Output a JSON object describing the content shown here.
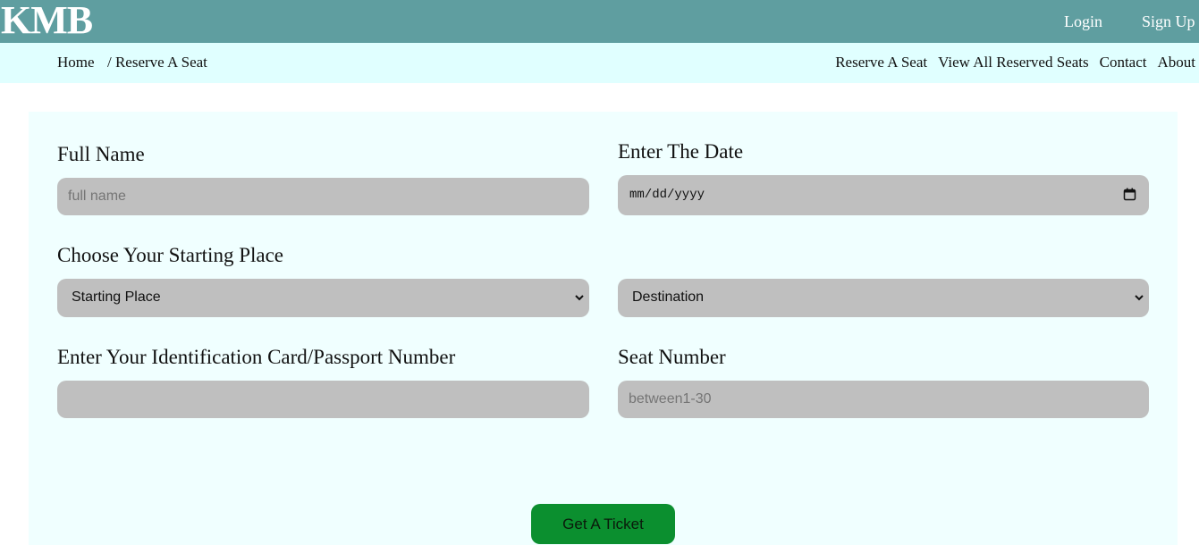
{
  "header": {
    "logo": "KMB",
    "login_label": "Login",
    "signup_label": "Sign Up"
  },
  "breadcrumb": {
    "home": "Home",
    "current": "/ Reserve A Seat"
  },
  "nav": {
    "items": [
      "Reserve A Seat",
      "View All Reserved Seats",
      "Contact",
      "About"
    ]
  },
  "form": {
    "full_name": {
      "label": "Full Name",
      "placeholder": "full name",
      "value": ""
    },
    "date": {
      "label": "Enter The Date",
      "value": "mm/dd/yyyy"
    },
    "starting_place": {
      "label": "Choose Your Starting Place",
      "selected": "Starting Place"
    },
    "destination": {
      "selected": "Destination"
    },
    "id_number": {
      "label": "Enter Your Identification Card/Passport Number",
      "value": ""
    },
    "seat_number": {
      "label": "Seat Number",
      "placeholder": "between1-30",
      "value": ""
    },
    "submit_label": "Get A Ticket"
  },
  "colors": {
    "header_bg": "#5f9ea0",
    "subnav_bg": "#e0ffff",
    "panel_bg": "#f0ffff",
    "field_bg": "#bfbfbf",
    "button_bg": "#0b8f2f"
  }
}
